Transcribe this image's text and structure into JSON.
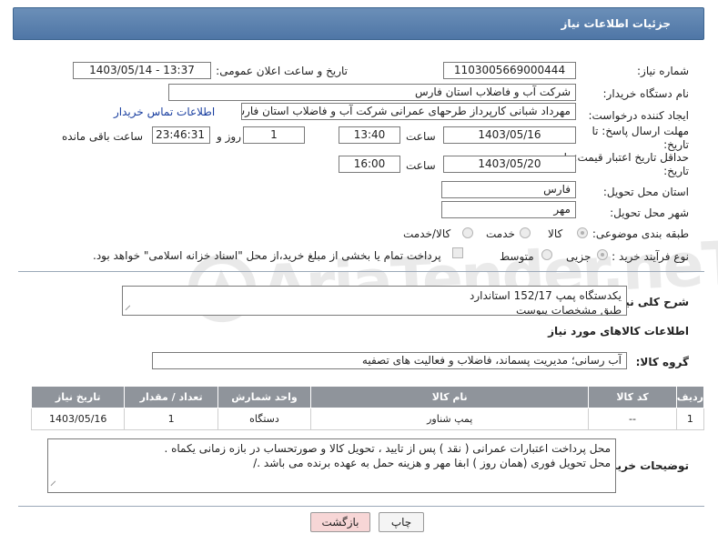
{
  "header": {
    "title": "جزئیات اطلاعات نیاز"
  },
  "fields": {
    "need_number_label": "شماره نیاز:",
    "need_number": "1103005669000444",
    "announce_label": "تاریخ و ساعت اعلان عمومی:",
    "announce_value": "1403/05/14 - 13:37",
    "buyer_org_label": "نام دستگاه خریدار:",
    "buyer_org": "شرکت آب و فاضلاب استان فارس",
    "requester_label": "ایجاد کننده درخواست:",
    "requester": "مهرداد شبانی کارپرداز طرحهای عمرانی  شرکت آب و فاضلاب استان فارس",
    "buyer_contact_link": "اطلاعات تماس خریدار",
    "deadline_label_1": "مهلت ارسال پاسخ: تا",
    "deadline_label_2": "تاریخ:",
    "deadline_date": "1403/05/16",
    "time_label": "ساعت",
    "deadline_time": "13:40",
    "days_value": "1",
    "days_label": "روز و",
    "remaining_time": "23:46:31",
    "remaining_label": "ساعت باقی مانده",
    "validity_label_1": "حداقل تاریخ اعتبار قیمت: تا",
    "validity_label_2": "تاریخ:",
    "validity_date": "1403/05/20",
    "validity_time_label": "ساعت",
    "validity_time": "16:00",
    "province_label": "استان محل تحویل:",
    "province": "فارس",
    "city_label": "شهر محل تحویل:",
    "city": "مهر",
    "category_label": "طبقه بندی موضوعی:",
    "category_options": [
      "کالا",
      "خدمت",
      "کالا/خدمت"
    ],
    "purchase_type_label": "نوع فرآیند خرید :",
    "purchase_type_options": [
      "جزیی",
      "متوسط"
    ],
    "payment_note": "پرداخت تمام یا بخشی از مبلغ خرید،از محل \"اسناد خزانه اسلامی\" خواهد بود."
  },
  "description": {
    "label": "شرح کلی نیاز:",
    "lines": [
      "یکدستگاه پمپ 152/17 استاندارد",
      "طبق مشخصات پیوست"
    ]
  },
  "goods_info": {
    "title": "اطلاعات کالاهای مورد نیاز",
    "group_label": "گروه کالا:",
    "group_value": "آب رسانی؛ مدیریت پسماند، فاضلاب و فعالیت های تصفیه"
  },
  "table": {
    "headers": [
      "ردیف",
      "کد کالا",
      "نام کالا",
      "واحد شمارش",
      "تعداد / مقدار",
      "تاریخ نیاز"
    ],
    "rows": [
      [
        "1",
        "--",
        "پمپ شناور",
        "دستگاه",
        "1",
        "1403/05/16"
      ]
    ]
  },
  "buyer_notes": {
    "label": "توضیحات خریدار:",
    "lines": [
      "محل پرداخت اعتبارات عمرانی ( نقد ) پس از تایید ، تحویل کالا و صورتحساب در بازه زمانی یکماه .",
      "محل تحویل فوری (همان روز ) ابفا مهر و هزینه حمل به عهده برنده می باشد ./"
    ]
  },
  "buttons": {
    "print": "چاپ",
    "back": "بازگشت"
  },
  "watermark": {
    "text": "AriaTender.neT"
  },
  "colors": {
    "header": "#5a7fae",
    "table_header": "#8f949b",
    "back_button": "#f7d6d6",
    "print_button": "#f4f4f4"
  }
}
